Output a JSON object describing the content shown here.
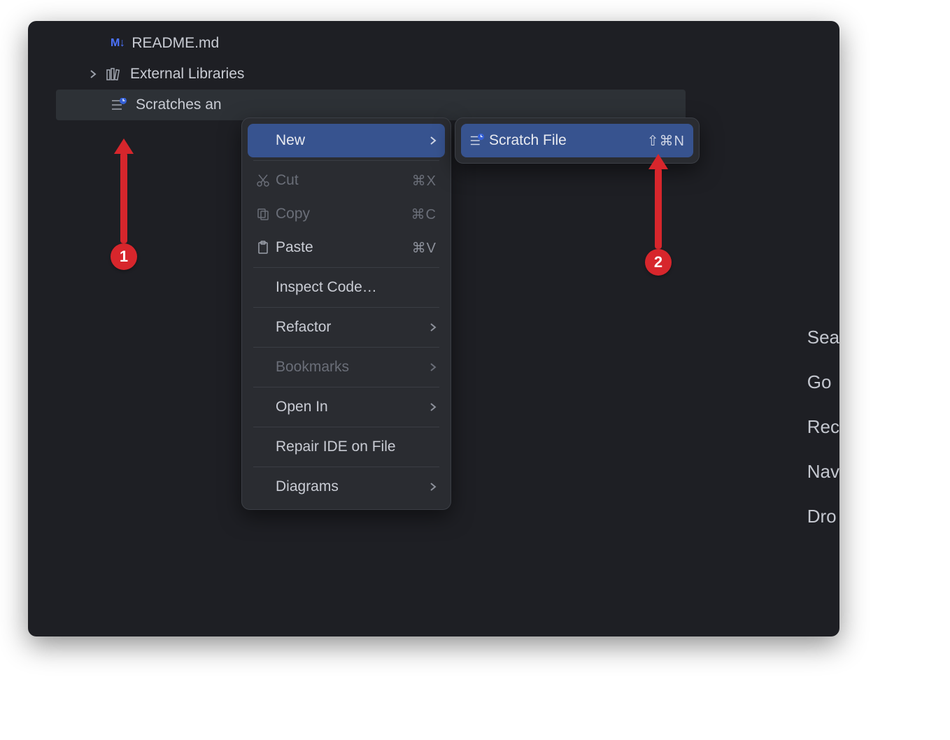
{
  "tree": {
    "readme_label": "README.md",
    "ext_lib_label": "External Libraries",
    "scratches_label": "Scratches an"
  },
  "context_menu": {
    "items": [
      {
        "label": "New",
        "shortcut": "",
        "submenu": true,
        "disabled": false,
        "highlighted": true,
        "icon": ""
      },
      {
        "sep": true
      },
      {
        "label": "Cut",
        "shortcut": "⌘X",
        "submenu": false,
        "disabled": true,
        "highlighted": false,
        "icon": "cut"
      },
      {
        "label": "Copy",
        "shortcut": "⌘C",
        "submenu": false,
        "disabled": true,
        "highlighted": false,
        "icon": "copy"
      },
      {
        "label": "Paste",
        "shortcut": "⌘V",
        "submenu": false,
        "disabled": false,
        "highlighted": false,
        "icon": "paste"
      },
      {
        "sep": true
      },
      {
        "label": "Inspect Code…",
        "shortcut": "",
        "submenu": false,
        "disabled": false,
        "highlighted": false,
        "icon": ""
      },
      {
        "sep": true
      },
      {
        "label": "Refactor",
        "shortcut": "",
        "submenu": true,
        "disabled": false,
        "highlighted": false,
        "icon": ""
      },
      {
        "sep": true
      },
      {
        "label": "Bookmarks",
        "shortcut": "",
        "submenu": true,
        "disabled": true,
        "highlighted": false,
        "icon": ""
      },
      {
        "sep": true
      },
      {
        "label": "Open In",
        "shortcut": "",
        "submenu": true,
        "disabled": false,
        "highlighted": false,
        "icon": ""
      },
      {
        "sep": true
      },
      {
        "label": "Repair IDE on File",
        "shortcut": "",
        "submenu": false,
        "disabled": false,
        "highlighted": false,
        "icon": ""
      },
      {
        "sep": true
      },
      {
        "label": "Diagrams",
        "shortcut": "",
        "submenu": true,
        "disabled": false,
        "highlighted": false,
        "icon": ""
      }
    ]
  },
  "submenu": {
    "items": [
      {
        "label": "Scratch File",
        "shortcut": "⇧⌘N",
        "highlighted": true,
        "icon": "scratch"
      }
    ]
  },
  "hints": {
    "items": [
      "Sea",
      "Go",
      "Rec",
      "Nav",
      "Dro"
    ]
  },
  "annotations": {
    "badge1": "1",
    "badge2": "2"
  },
  "colors": {
    "accent_red": "#d7262c",
    "menu_highlight": "#37538f",
    "bg": "#1e1f24"
  }
}
